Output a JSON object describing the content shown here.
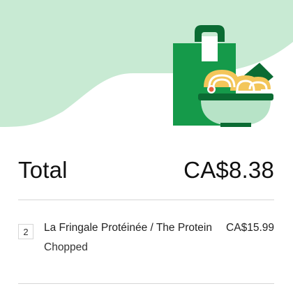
{
  "colors": {
    "hero_background": "#c8ead3",
    "bag_green": "#159a4a",
    "bag_dark": "#0b6b33",
    "bowl": "#b7e3c7",
    "noodle": "#f3c65a"
  },
  "hero": {
    "illustration": "grocery-bag-with-noodle-bowl-icon"
  },
  "summary": {
    "total_label": "Total",
    "total_amount": "CA$8.38"
  },
  "items": [
    {
      "quantity": "2",
      "name": "La Fringale Protéinée / The Protein",
      "price": "CA$15.99",
      "modifier": "Chopped"
    }
  ]
}
